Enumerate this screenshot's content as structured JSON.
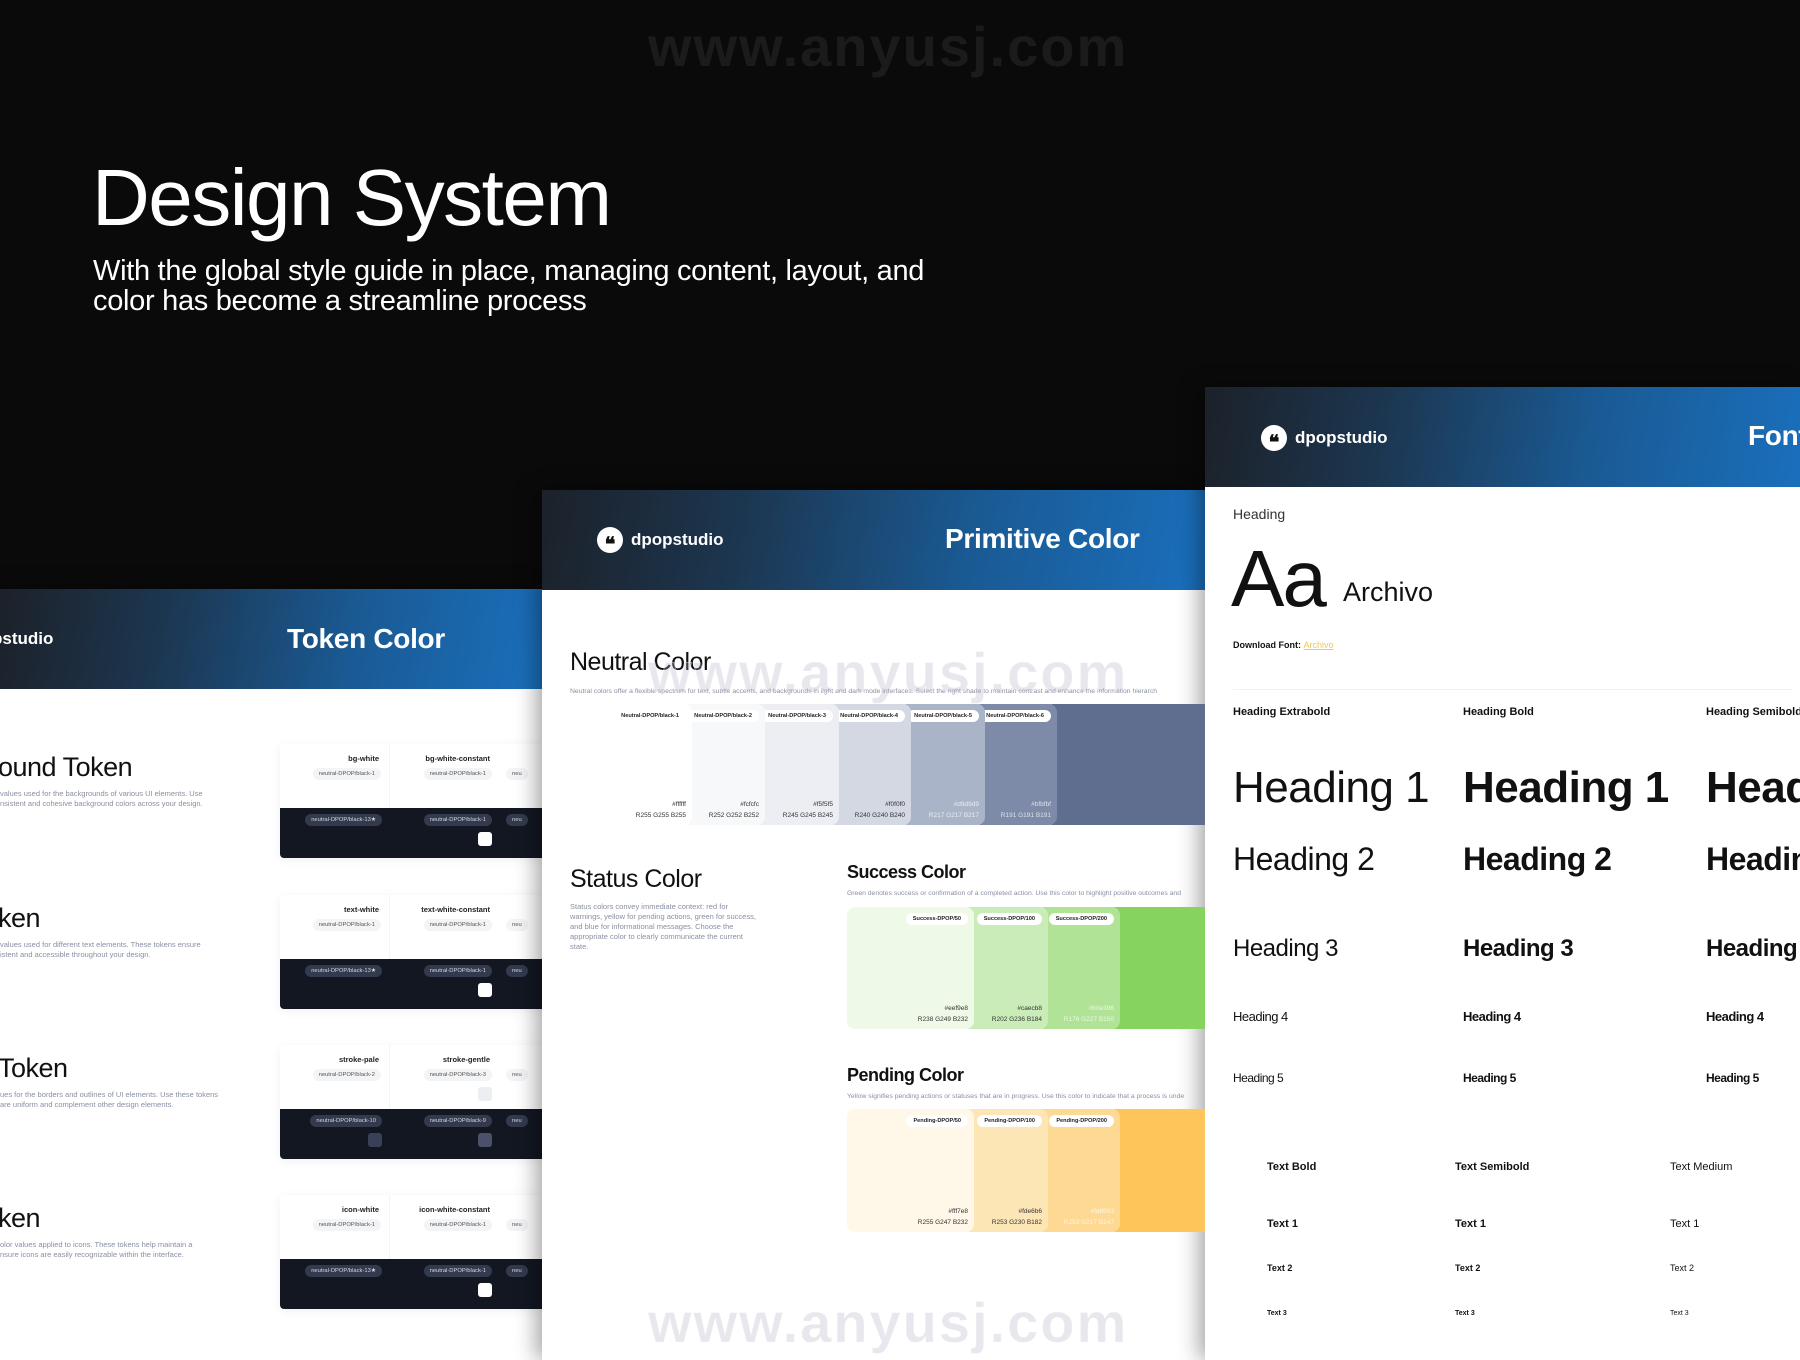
{
  "hero": {
    "title": "Design System",
    "subtitle": "With the global style guide in place, managing content, layout, and color has become a streamline process"
  },
  "watermark": "www.anyusj.com",
  "brand": {
    "logo_text": "dpopstudio",
    "logo_text_cut": "pstudio",
    "gradient_from": "#1c2129",
    "gradient_to": "#1a6fbc"
  },
  "token_panel": {
    "header_title": "Token Color",
    "sections": [
      {
        "title": "ound Token",
        "desc": [
          "values used for the backgrounds of various UI elements. Use",
          "nsistent and cohesive background colors across your design."
        ],
        "cols": [
          {
            "name": "bg-white",
            "light": "neutral-DPOP/black-1",
            "dark": "neutral-DPOP/black-13★",
            "light_sq": "",
            "dark_sq": ""
          },
          {
            "name": "bg-white-constant",
            "light": "neutral-DPOP/black-1",
            "dark": "neutral-DPOP/black-1",
            "light_sq": "",
            "dark_sq": "#ffffff"
          }
        ],
        "partial": "neu"
      },
      {
        "title": "ken",
        "desc": [
          "values used for different text elements. These tokens ensure",
          "istent and accessible throughout your design."
        ],
        "cols": [
          {
            "name": "text-white",
            "light": "neutral-DPOP/black-1",
            "dark": "neutral-DPOP/black-13★",
            "light_sq": "",
            "dark_sq": ""
          },
          {
            "name": "text-white-constant",
            "light": "neutral-DPOP/black-1",
            "dark": "neutral-DPOP/black-1",
            "light_sq": "",
            "dark_sq": "#ffffff"
          }
        ],
        "partial": "neu"
      },
      {
        "title": "Token",
        "desc": [
          "ues for the borders and outlines of UI elements. Use these tokens",
          "are uniform and complement other design elements."
        ],
        "cols": [
          {
            "name": "stroke-pale",
            "light": "neutral-DPOP/black-2",
            "dark": "neutral-DPOP/black-10",
            "light_sq": "",
            "dark_sq": "#3a4156"
          },
          {
            "name": "stroke-gentle",
            "light": "neutral-DPOP/black-3",
            "dark": "neutral-DPOP/black-9",
            "light_sq": "#eceef2",
            "dark_sq": "#4a5168"
          }
        ],
        "partial": "neu"
      },
      {
        "title": "ken",
        "desc": [
          "olor values applied to icons. These tokens help maintain a",
          "nsure icons are easily recognizable within the interface."
        ],
        "cols": [
          {
            "name": "icon-white",
            "light": "neutral-DPOP/black-1",
            "dark": "neutral-DPOP/black-13★",
            "light_sq": "",
            "dark_sq": ""
          },
          {
            "name": "icon-white-constant",
            "light": "neutral-DPOP/black-1",
            "dark": "neutral-DPOP/black-1",
            "light_sq": "",
            "dark_sq": "#ffffff"
          }
        ],
        "partial": "neu"
      }
    ]
  },
  "primitive_panel": {
    "header_title": "Primitive Color",
    "neutral": {
      "title": "Neutral Color",
      "desc": "Neutral colors offer a flexible spectrum for text, subtle accents, and backgrounds in light and dark mode interfaces. Select the right shade to maintain contrast and enhance the information hierarch",
      "swatches": [
        {
          "label": "Neutral-DPOP/black-1",
          "hex": "#ffffff",
          "rgb": "R255 G255 B255",
          "color": "#ffffff"
        },
        {
          "label": "Neutral-DPOP/black-2",
          "hex": "#fcfcfc",
          "rgb": "R252 G252 B252",
          "color": "#f7f8fa"
        },
        {
          "label": "Neutral-DPOP/black-3",
          "hex": "#f5f5f5",
          "rgb": "R245 G245 B245",
          "color": "#eceef3"
        },
        {
          "label": "Neutral-DPOP/black-4",
          "hex": "#f0f0f0",
          "rgb": "R240 G240 B240",
          "color": "#d3d8e2"
        },
        {
          "label": "Neutral-DPOP/black-5",
          "hex": "#d9d9d9",
          "rgb": "R217 G217 B217",
          "color": "#aab4c8"
        },
        {
          "label": "Neutral-DPOP/black-6",
          "hex": "#bfbfbf",
          "rgb": "R191 G191 B191",
          "color": "#7d8aa8"
        },
        {
          "label": "Ne",
          "hex": "",
          "rgb": "",
          "color": "#5f6e8e"
        }
      ]
    },
    "status": {
      "title": "Status Color",
      "desc": [
        "Status colors convey immediate context: red for",
        "warnings, yellow for pending actions, green for success,",
        "and blue for informational messages. Choose the",
        "appropriate color to clearly communicate the current",
        "state."
      ]
    },
    "success": {
      "title": "Success Color",
      "desc": "Green denotes success or confirmation of a completed action. Use this color to highlight positive outcomes and",
      "swatches": [
        {
          "label": "Success-DPOP/50",
          "hex": "#eef9e8",
          "rgb": "R238 G249 B232",
          "color": "#eef9e8"
        },
        {
          "label": "Success-DPOP/100",
          "hex": "#caecb8",
          "rgb": "R202 G236 B184",
          "color": "#caecb8"
        },
        {
          "label": "Success-DPOP/200",
          "hex": "#b0e396",
          "rgb": "R176 G227 B150",
          "color": "#b0e396"
        },
        {
          "label": "",
          "hex": "",
          "rgb": "",
          "color": "#86d45f"
        }
      ]
    },
    "pending": {
      "title": "Pending Color",
      "desc": "Yellow signifies pending actions or statuses that are in progress. Use this color to indicate that a process is unde",
      "swatches": [
        {
          "label": "Pending-DPOP/50",
          "hex": "#fff7e8",
          "rgb": "R255 G247 B232",
          "color": "#fff7e8"
        },
        {
          "label": "Pending-DPOP/100",
          "hex": "#fde6b6",
          "rgb": "R253 G230 B182",
          "color": "#fde6b6"
        },
        {
          "label": "Pending-DPOP/200",
          "hex": "#fdd993",
          "rgb": "R253 G217 B147",
          "color": "#fdd993"
        },
        {
          "label": "",
          "hex": "",
          "rgb": "",
          "color": "#fec55a"
        }
      ]
    }
  },
  "font_panel": {
    "header_title": "Font",
    "heading_label": "Heading",
    "sample": "Aa",
    "font_name": "Archivo",
    "download_label": "Download Font:",
    "download_link": "Archivo",
    "link_color": "#f2c94c",
    "heading_columns": [
      {
        "label": "Heading Extrabold",
        "weight": "400"
      },
      {
        "label": "Heading Bold",
        "weight": "700"
      },
      {
        "label": "Heading Semibold",
        "weight": "700"
      }
    ],
    "heading_items": [
      "Heading 1",
      "Heading 2",
      "Heading 3",
      "Heading 4",
      "Heading 5"
    ],
    "text_columns": [
      {
        "label": "Text Bold",
        "weight": "700"
      },
      {
        "label": "Text Semibold",
        "weight": "700"
      },
      {
        "label": "Text Medium",
        "weight": "400"
      }
    ],
    "text_items": [
      "Text 1",
      "Text 2",
      "Text 3"
    ]
  }
}
